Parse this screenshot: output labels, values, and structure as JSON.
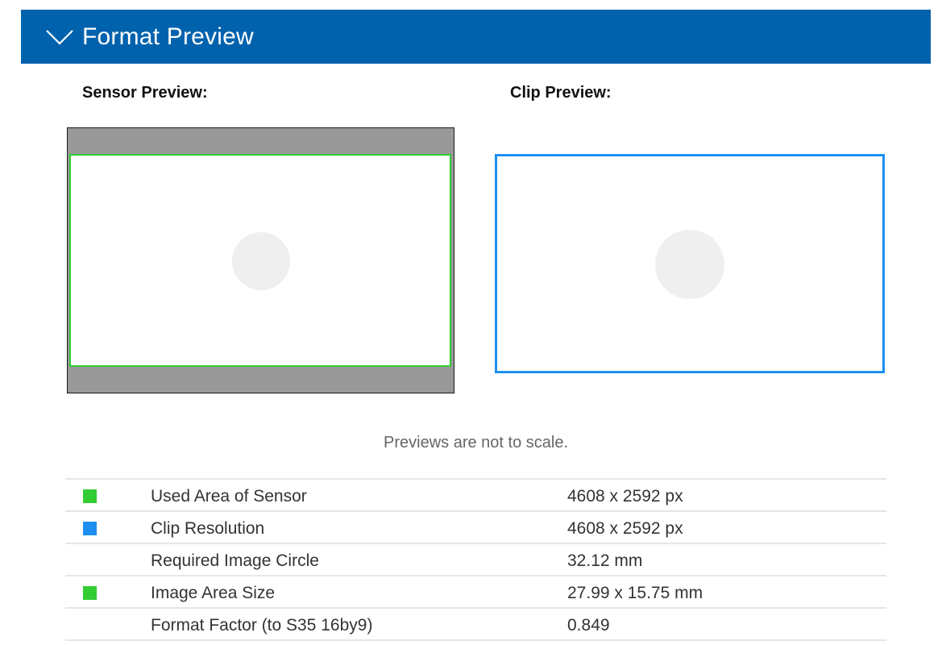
{
  "header": {
    "title": "Format Preview",
    "toggle_icon": "chevron-down-icon"
  },
  "previews": {
    "sensor_label": "Sensor Preview:",
    "clip_label": "Clip Preview:",
    "note": "Previews are not to scale."
  },
  "colors": {
    "header_bg": "#0062ad",
    "sensor_used_area": "#33cc33",
    "clip_resolution": "#1e8ff0",
    "sensor_bg": "#999999"
  },
  "table": {
    "rows": [
      {
        "name": "Used Area of Sensor",
        "value": "4608 x 2592 px",
        "swatch": "#33cc33"
      },
      {
        "name": "Clip Resolution",
        "value": "4608 x 2592 px",
        "swatch": "#1e8ff0"
      },
      {
        "name": "Required Image Circle",
        "value": "32.12 mm",
        "swatch": null
      },
      {
        "name": "Image Area Size",
        "value": "27.99 x 15.75 mm",
        "swatch": "#33cc33"
      },
      {
        "name": "Format Factor (to S35 16by9)",
        "value": "0.849",
        "swatch": null
      }
    ]
  }
}
